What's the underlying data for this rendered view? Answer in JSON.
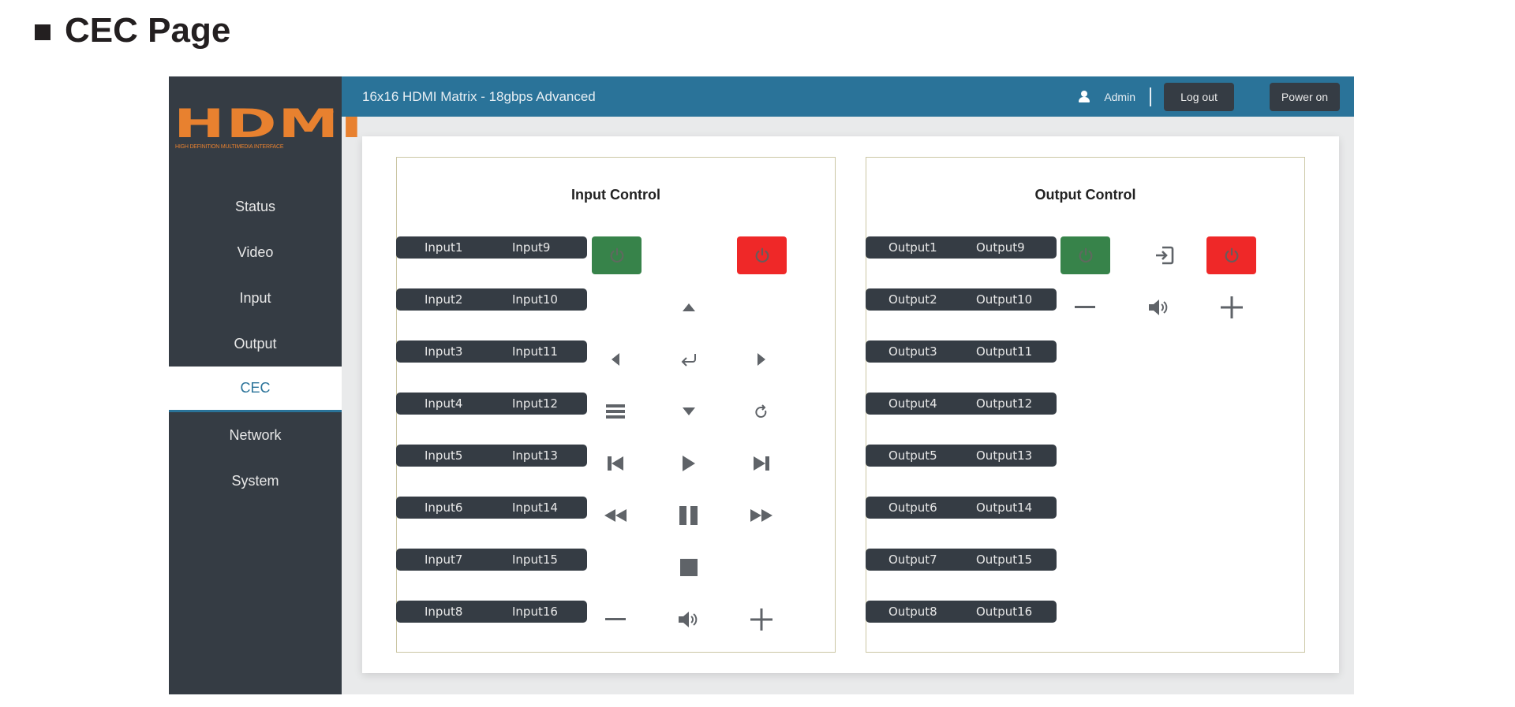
{
  "page_heading": "CEC Page",
  "app": {
    "title": "16x16 HDMI Matrix - 18gbps Advanced",
    "logo": {
      "mark": "HDMI",
      "registered": "®",
      "tagline": "HIGH DEFINITION MULTIMEDIA INTERFACE"
    },
    "user": {
      "icon": "user-icon",
      "name": "Admin"
    },
    "buttons": {
      "logout": "Log out",
      "power_on": "Power on"
    }
  },
  "sidebar": {
    "items": [
      {
        "label": "Status",
        "active": false
      },
      {
        "label": "Video",
        "active": false
      },
      {
        "label": "Input",
        "active": false
      },
      {
        "label": "Output",
        "active": false
      },
      {
        "label": "CEC",
        "active": true
      },
      {
        "label": "Network",
        "active": false
      },
      {
        "label": "System",
        "active": false
      }
    ]
  },
  "input_control": {
    "title": "Input Control",
    "rows": [
      [
        "Input1",
        "Input9"
      ],
      [
        "Input2",
        "Input10"
      ],
      [
        "Input3",
        "Input11"
      ],
      [
        "Input4",
        "Input12"
      ],
      [
        "Input5",
        "Input13"
      ],
      [
        "Input6",
        "Input14"
      ],
      [
        "Input7",
        "Input15"
      ],
      [
        "Input8",
        "Input16"
      ]
    ],
    "keypad": [
      "power-on-icon",
      "power-off-icon",
      "up-arrow-icon",
      "left-arrow-icon",
      "enter-icon",
      "right-arrow-icon",
      "menu-icon",
      "down-arrow-icon",
      "back-icon",
      "previous-track-icon",
      "play-icon",
      "next-track-icon",
      "rewind-icon",
      "pause-icon",
      "fast-forward-icon",
      "stop-icon",
      "volume-down-icon",
      "mute-icon",
      "volume-up-icon"
    ]
  },
  "output_control": {
    "title": "Output Control",
    "rows": [
      [
        "Output1",
        "Output9"
      ],
      [
        "Output2",
        "Output10"
      ],
      [
        "Output3",
        "Output11"
      ],
      [
        "Output4",
        "Output12"
      ],
      [
        "Output5",
        "Output13"
      ],
      [
        "Output6",
        "Output14"
      ],
      [
        "Output7",
        "Output15"
      ],
      [
        "Output8",
        "Output16"
      ]
    ],
    "keypad": [
      "power-on-icon",
      "source-icon",
      "power-off-icon",
      "volume-down-icon",
      "mute-icon",
      "volume-up-icon"
    ]
  },
  "colors": {
    "header": "#2a7399",
    "sidebar": "#353c44",
    "logo": "#e8812f",
    "power_on": "#37834a",
    "power_off": "#ef2828",
    "icon": "#5f6368"
  }
}
